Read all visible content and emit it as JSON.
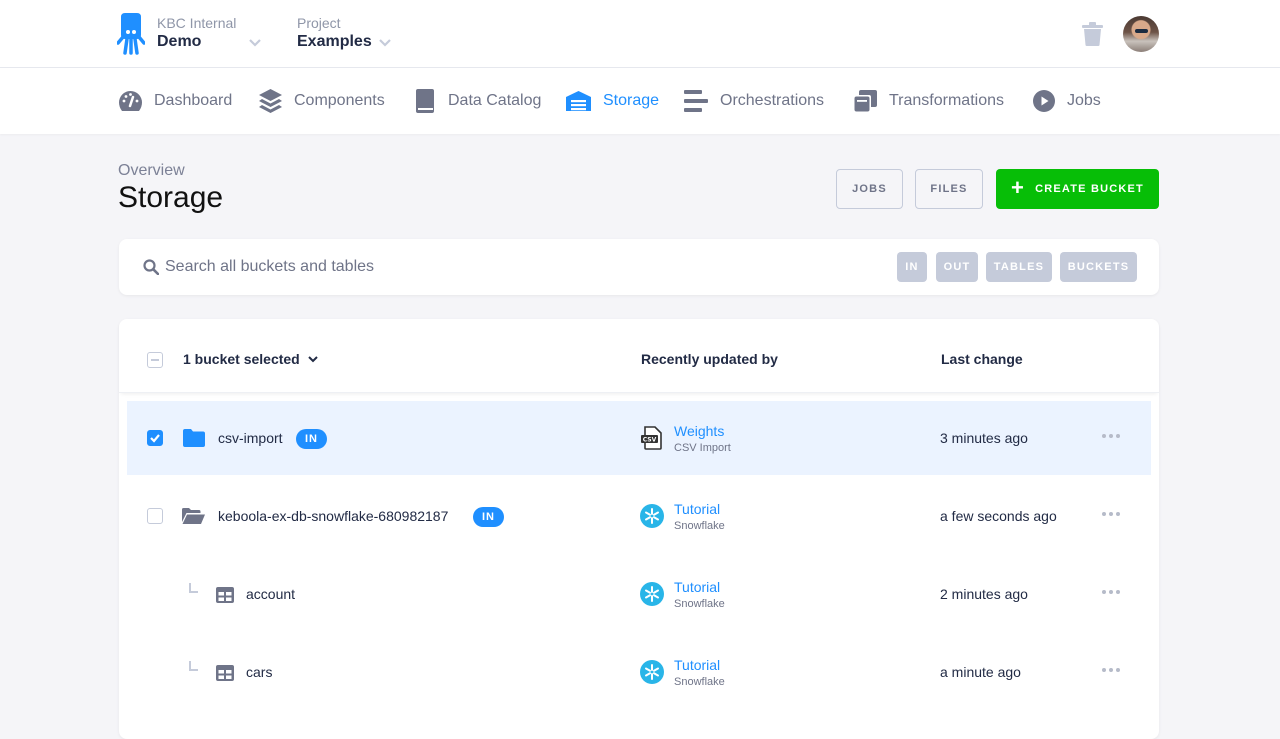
{
  "topbar": {
    "organization": {
      "label": "KBC Internal",
      "value": "Demo"
    },
    "project": {
      "label": "Project",
      "value": "Examples"
    },
    "trash_icon": "trash-icon",
    "avatar": "user-avatar"
  },
  "nav": {
    "items": [
      {
        "label": "Dashboard",
        "icon": "gauge-icon",
        "active": false
      },
      {
        "label": "Components",
        "icon": "layers-icon",
        "active": false
      },
      {
        "label": "Data Catalog",
        "icon": "book-icon",
        "active": false
      },
      {
        "label": "Storage",
        "icon": "warehouse-icon",
        "active": true
      },
      {
        "label": "Orchestrations",
        "icon": "bars-icon",
        "active": false
      },
      {
        "label": "Transformations",
        "icon": "windows-icon",
        "active": false
      },
      {
        "label": "Jobs",
        "icon": "play-circle-icon",
        "active": false
      }
    ]
  },
  "header": {
    "breadcrumb": "Overview",
    "title": "Storage",
    "buttons": {
      "jobs": "JOBS",
      "files": "FILES",
      "create": "CREATE BUCKET"
    }
  },
  "search": {
    "placeholder": "Search all buckets and tables",
    "value": "",
    "filters": [
      "IN",
      "OUT",
      "TABLES",
      "BUCKETS"
    ]
  },
  "table": {
    "selection_label": "1 bucket selected",
    "columns": {
      "updated_by": "Recently updated by",
      "last_change": "Last change"
    },
    "rows": [
      {
        "type": "bucket",
        "name": "csv-import",
        "stage": "IN",
        "checked": true,
        "updater": "Weights",
        "component": "CSV Import",
        "component_icon": "csv-file-icon",
        "last_change": "3 minutes ago"
      },
      {
        "type": "bucket",
        "name": "keboola-ex-db-snowflake-680982187",
        "stage": "IN",
        "checked": false,
        "updater": "Tutorial",
        "component": "Snowflake",
        "component_icon": "snowflake-icon",
        "last_change": "a few seconds ago"
      },
      {
        "type": "table",
        "name": "account",
        "updater": "Tutorial",
        "component": "Snowflake",
        "component_icon": "snowflake-icon",
        "last_change": "2 minutes ago"
      },
      {
        "type": "table",
        "name": "cars",
        "updater": "Tutorial",
        "component": "Snowflake",
        "component_icon": "snowflake-icon",
        "last_change": "a minute ago"
      }
    ]
  },
  "colors": {
    "accent": "#1f8fff",
    "create": "#07be07",
    "selected_row": "#ebf3ff",
    "muted": "#c5cbda"
  }
}
